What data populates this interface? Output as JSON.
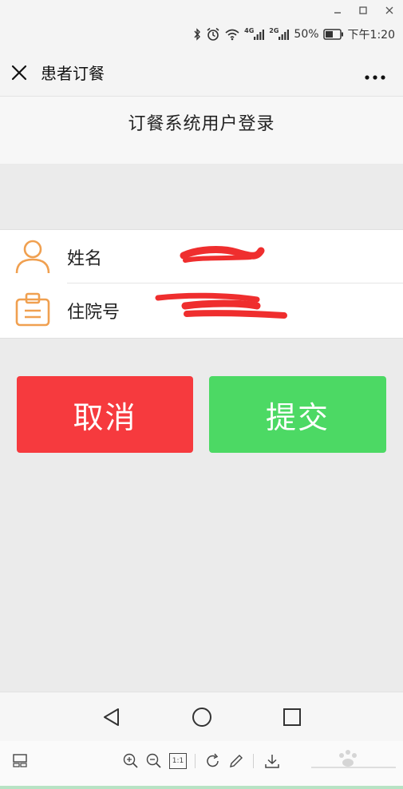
{
  "status": {
    "network_1": "4G",
    "network_2": "2G",
    "battery": "50%",
    "time": "下午1:20"
  },
  "header": {
    "title": "患者订餐"
  },
  "page": {
    "title": "订餐系统用户登录"
  },
  "form": {
    "name_label": "姓名",
    "name_value": "",
    "hospital_no_label": "住院号",
    "hospital_no_value": ""
  },
  "buttons": {
    "cancel_label": "取消",
    "submit_label": "提交"
  },
  "toolbar": {
    "actual_size_label": "1:1"
  },
  "colors": {
    "cancel": "#f63a3e",
    "submit": "#4cd964",
    "icon_orange": "#f0a050"
  }
}
